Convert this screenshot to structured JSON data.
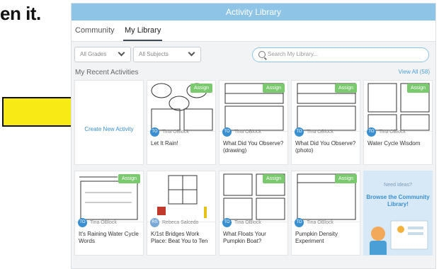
{
  "overlay": {
    "text": "en it."
  },
  "window": {
    "title": "Activity Library"
  },
  "tabs": [
    {
      "label": "Community"
    },
    {
      "label": "My Library"
    }
  ],
  "filters": {
    "grades": "All Grades",
    "subjects": "All Subjects",
    "search_placeholder": "Search My Library..."
  },
  "section": {
    "title": "My Recent Activities",
    "view_all": "View All (58)"
  },
  "create_label": "Create New Activity",
  "assign_label": "Assign",
  "cards": [
    {
      "author": "Tina OBlock",
      "initials": "TO",
      "title": "Let It Rain!"
    },
    {
      "author": "Tina OBlock",
      "initials": "TO",
      "title": "What Did You Observe? (drawing)"
    },
    {
      "author": "Tina OBlock",
      "initials": "TO",
      "title": "What Did You Observe? (photo)"
    },
    {
      "author": "Tina OBlock",
      "initials": "TO",
      "title": "Water Cycle Wisdom"
    },
    {
      "author": "Tina OBlock",
      "initials": "TO",
      "title": "It's Raining Water Cycle Words"
    },
    {
      "author": "Rebeca Salcedo",
      "initials": "RS",
      "title": "K/1st Bridges Work Place: Beat You to Ten"
    },
    {
      "author": "Tina OBlock",
      "initials": "TO",
      "title": "What Floats Your Pumpkin Boat?"
    },
    {
      "author": "Tina OBlock",
      "initials": "TO",
      "title": "Pumpkin Density Experiment"
    }
  ],
  "ideas": {
    "question": "Need Ideas?",
    "browse": "Browse the Community Library!"
  },
  "colors": {
    "titlebar": "#8ec5e6",
    "assign": "#7bc96f",
    "arrow_fill": "#f7ea15",
    "link": "#3a8fd0"
  }
}
